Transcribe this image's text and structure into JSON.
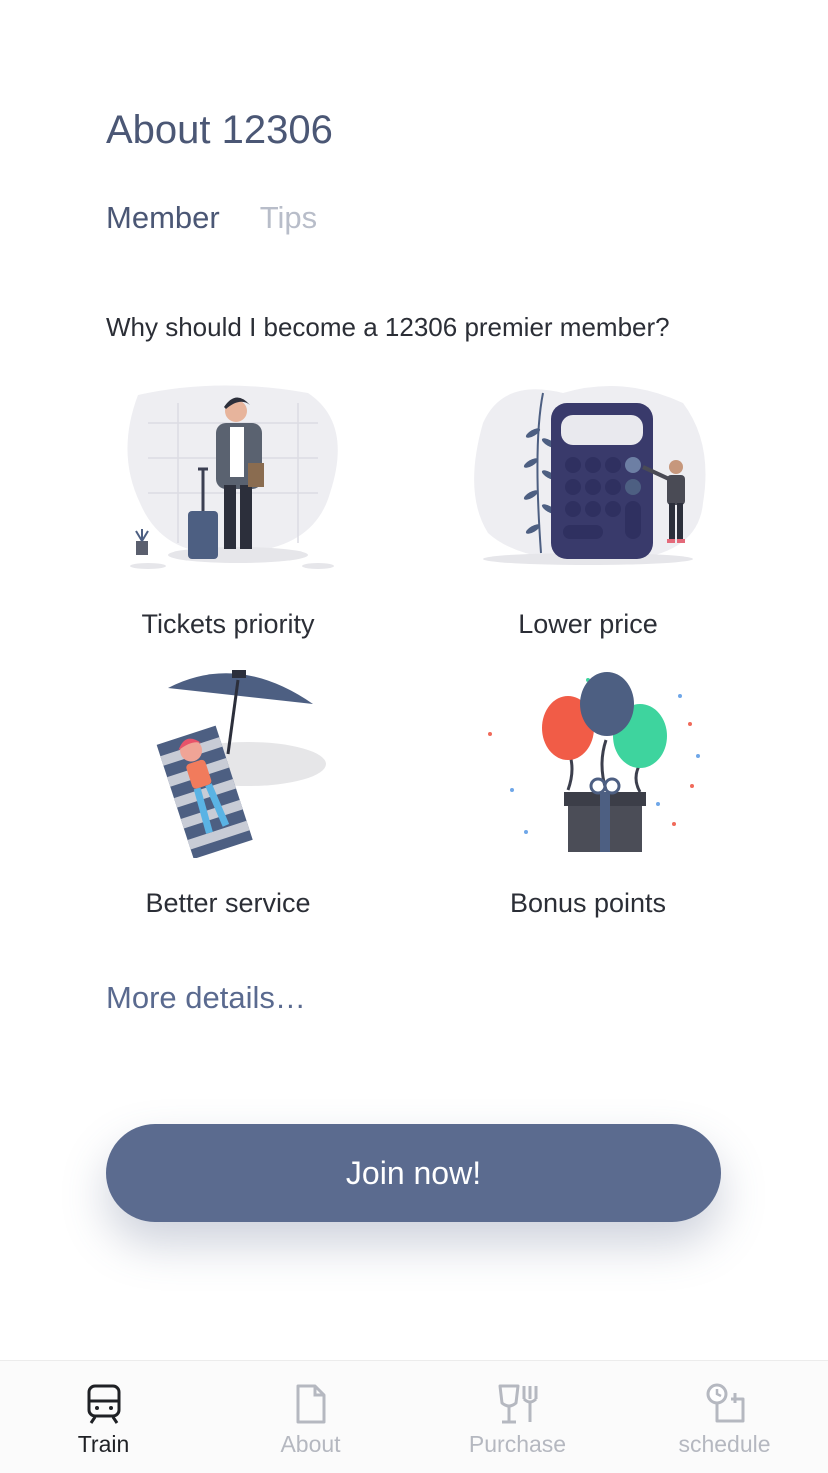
{
  "page": {
    "title": "About 12306",
    "tabs": [
      {
        "label": "Member",
        "active": true
      },
      {
        "label": "Tips",
        "active": false
      }
    ],
    "question": "Why should I become a 12306 premier member?"
  },
  "benefits": [
    {
      "label": "Tickets priority",
      "icon": "traveler-illustration"
    },
    {
      "label": "Lower price",
      "icon": "calculator-illustration"
    },
    {
      "label": "Better service",
      "icon": "beach-relax-illustration"
    },
    {
      "label": "Bonus points",
      "icon": "gift-balloons-illustration"
    }
  ],
  "more_details": "More details…",
  "join_button": "Join now!",
  "tabbar": [
    {
      "label": "Train",
      "icon": "train-icon",
      "active": true
    },
    {
      "label": "About",
      "icon": "document-icon",
      "active": false
    },
    {
      "label": "Purchase",
      "icon": "dining-icon",
      "active": false
    },
    {
      "label": "schedule",
      "icon": "schedule-icon",
      "active": false
    }
  ],
  "colors": {
    "accent": "#5b6b8f",
    "title": "#4b5775",
    "inactive": "#b8bdc9"
  }
}
